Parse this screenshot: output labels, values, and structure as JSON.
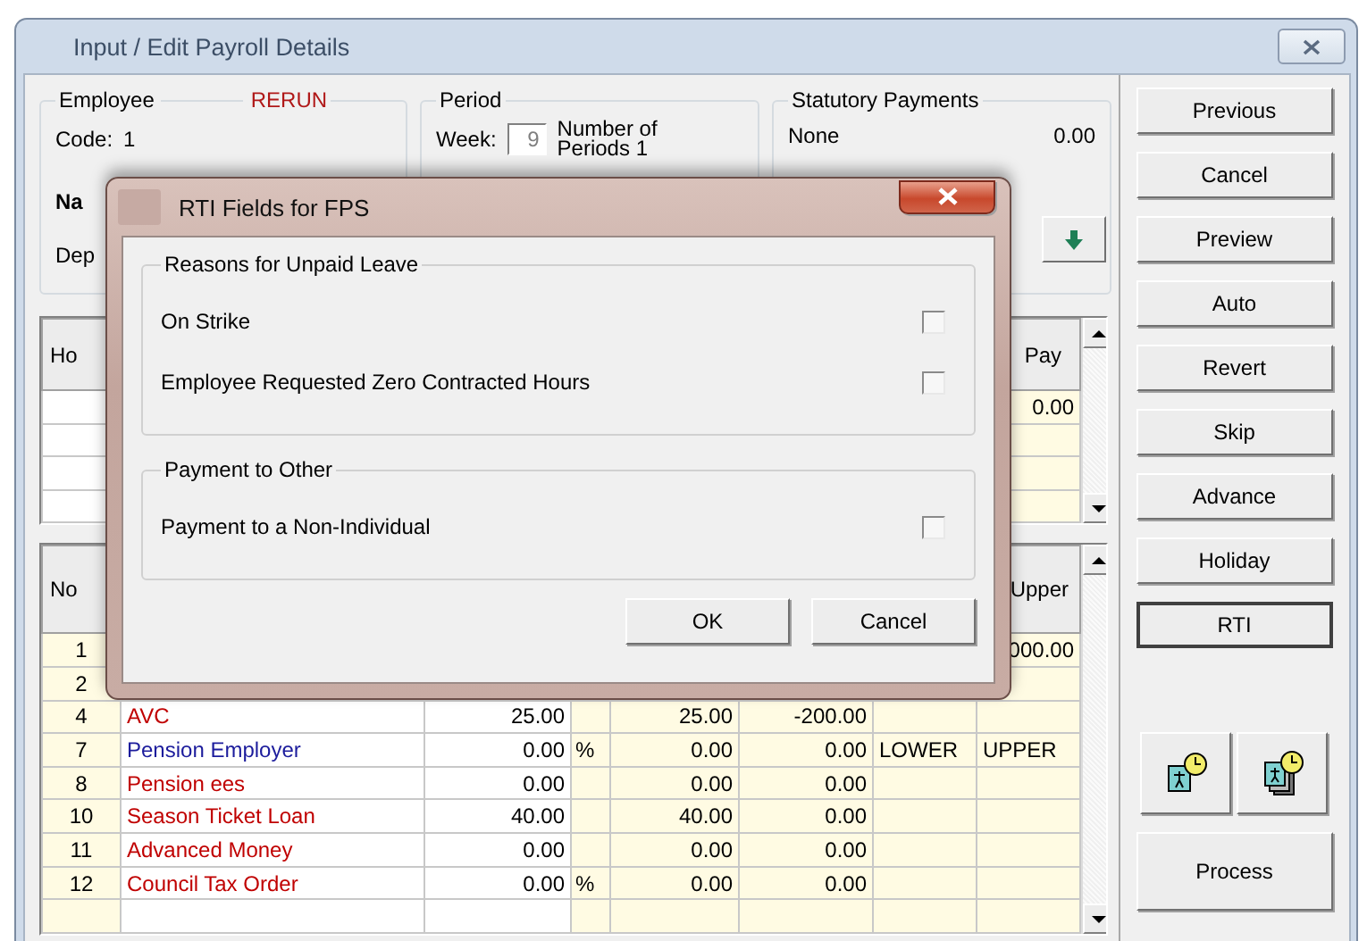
{
  "window": {
    "title": "Input / Edit Payroll Details"
  },
  "employee": {
    "label": "Employee",
    "status": "RERUN",
    "code_label": "Code:",
    "code": "1",
    "name_label": "Na",
    "department_label": "Dep"
  },
  "period": {
    "label": "Period",
    "week_label": "Week:",
    "week": "9",
    "periods": "Number of Periods 1"
  },
  "statutory_payments": {
    "label": "Statutory Payments",
    "type": "None",
    "amount": "0.00"
  },
  "upper_grid": {
    "columns": [
      "Ho",
      "Pay"
    ],
    "rows": [
      {
        "pay": "0.00"
      }
    ]
  },
  "lower_grid": {
    "columns": [
      "No",
      "Upper"
    ],
    "rows": [
      {
        "no": "1",
        "upper": "000.00"
      },
      {
        "no": "2"
      },
      {
        "no": "4",
        "name": "AVC",
        "color": "#c00000",
        "amount": "25.00",
        "column_5": "25.00",
        "column_6": "-200.00"
      },
      {
        "no": "7",
        "name": "Pension Employer",
        "color": "#1c1c9c",
        "amount": "0.00",
        "unit": "%",
        "column_5": "0.00",
        "column_6": "0.00",
        "lower": "LOWER",
        "upper": "UPPER"
      },
      {
        "no": "8",
        "name": "Pension ees",
        "color": "#c00000",
        "amount": "0.00",
        "column_5": "0.00",
        "column_6": "0.00"
      },
      {
        "no": "10",
        "name": "Season Ticket Loan",
        "color": "#c00000",
        "amount": "40.00",
        "column_5": "40.00",
        "column_6": "0.00"
      },
      {
        "no": "11",
        "name": "Advanced Money",
        "color": "#c00000",
        "amount": "0.00",
        "column_5": "0.00",
        "column_6": "0.00"
      },
      {
        "no": "12",
        "name": "Council Tax Order",
        "color": "#c00000",
        "amount": "0.00",
        "unit": "%",
        "column_5": "0.00",
        "column_6": "0.00"
      }
    ]
  },
  "side_buttons": [
    {
      "label": "Previous",
      "focused": false
    },
    {
      "label": "Cancel",
      "focused": false
    },
    {
      "label": "Preview",
      "focused": false
    },
    {
      "label": "Auto",
      "focused": false
    },
    {
      "label": "Revert",
      "focused": false
    },
    {
      "label": "Skip",
      "focused": false
    },
    {
      "label": "Advance",
      "focused": false
    },
    {
      "label": "Holiday",
      "focused": false
    },
    {
      "label": "RTI",
      "focused": true
    }
  ],
  "process_button": {
    "label": "Process"
  },
  "dialog": {
    "title": "RTI Fields for FPS",
    "groups": [
      {
        "label": "Reasons for Unpaid Leave",
        "items": [
          {
            "label": "On Strike",
            "checked": false
          },
          {
            "label": "Employee Requested Zero Contracted Hours",
            "checked": false
          }
        ]
      },
      {
        "label": "Payment to Other",
        "items": [
          {
            "label": "Payment to a Non-Individual",
            "checked": false
          }
        ]
      }
    ],
    "buttons": [
      "OK",
      "Cancel"
    ]
  }
}
